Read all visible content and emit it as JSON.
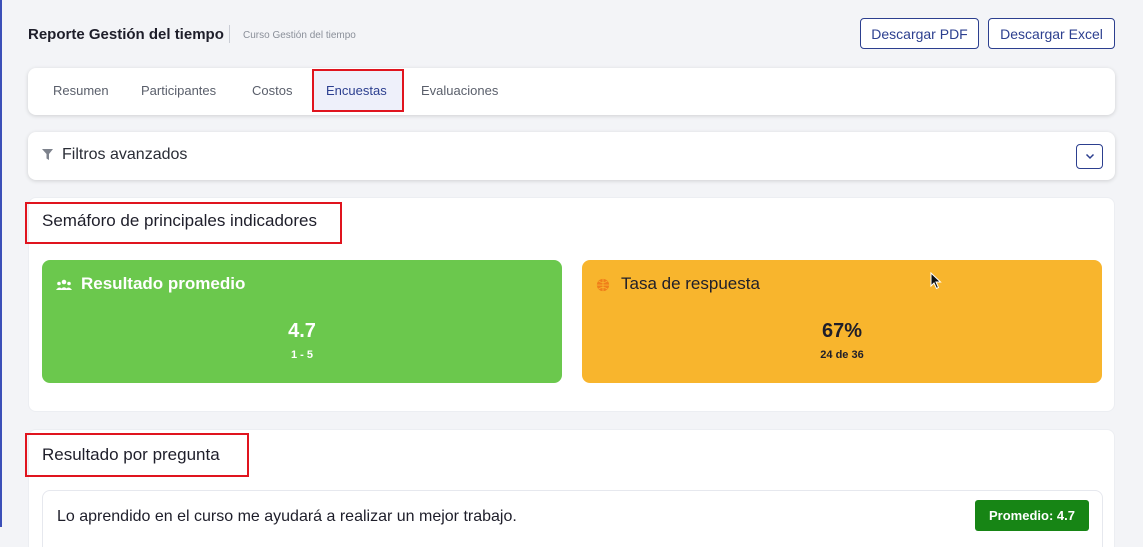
{
  "header": {
    "title": "Reporte Gestión del tiempo",
    "subtitle": "Curso Gestión del tiempo",
    "download_pdf": "Descargar PDF",
    "download_excel": "Descargar Excel"
  },
  "tabs": [
    {
      "label": "Resumen",
      "active": false
    },
    {
      "label": "Participantes",
      "active": false
    },
    {
      "label": "Costos",
      "active": false
    },
    {
      "label": "Encuestas",
      "active": true
    },
    {
      "label": "Evaluaciones",
      "active": false
    }
  ],
  "filters": {
    "label": "Filtros avanzados",
    "icon": "filter-icon",
    "toggle_icon": "chevron-down-icon"
  },
  "semaforo": {
    "title": "Semáforo de principales indicadores",
    "cards": [
      {
        "title": "Resultado promedio",
        "value": "4.7",
        "sub": "1 - 5",
        "icon": "users-icon",
        "color": "#6bc84d"
      },
      {
        "title": "Tasa de respuesta",
        "value": "67%",
        "sub": "24 de 36",
        "icon": "globe-icon",
        "color": "#f8b52d"
      }
    ]
  },
  "resultado": {
    "title": "Resultado por pregunta",
    "questions": [
      {
        "text": "Lo aprendido en el curso me ayudará a realizar un mejor trabajo.",
        "badge": "Promedio: 4.7"
      }
    ]
  },
  "colors": {
    "accent": "#2c3f8f",
    "highlight_box": "#e0141e",
    "badge_green": "#178515"
  }
}
